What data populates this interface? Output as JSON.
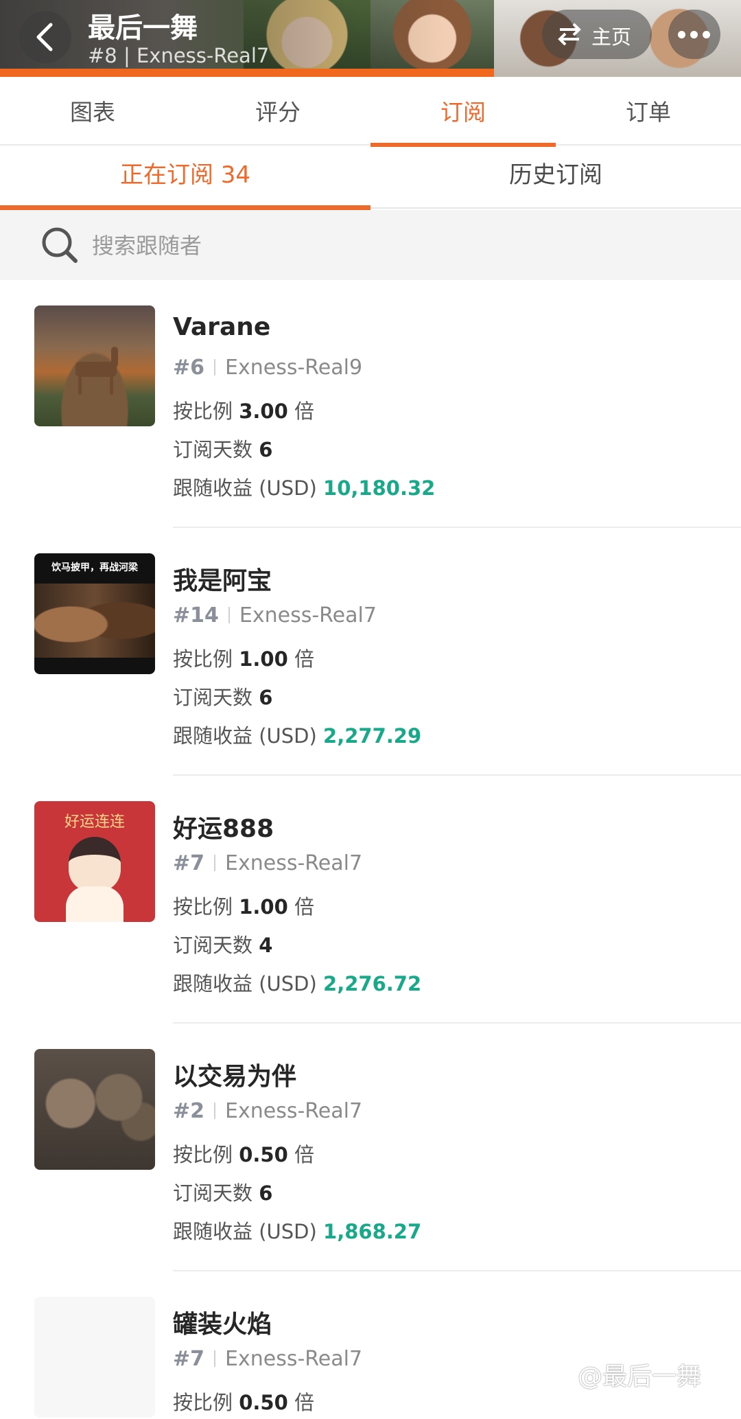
{
  "header": {
    "trader_name": "最后一舞",
    "trader_rank": "#8",
    "trader_account": "Exness-Real7",
    "home_label": "主页"
  },
  "tabs": [
    {
      "label": "图表",
      "active": false
    },
    {
      "label": "评分",
      "active": false
    },
    {
      "label": "订阅",
      "active": true
    },
    {
      "label": "订单",
      "active": false
    }
  ],
  "subtabs": {
    "current_label": "正在订阅 34",
    "history_label": "历史订阅"
  },
  "search": {
    "placeholder": "搜索跟随者"
  },
  "labels": {
    "ratio_prefix": "按比例",
    "ratio_suffix": "倍",
    "days_label": "订阅天数",
    "profit_label": "跟随收益 (USD)"
  },
  "followers": [
    {
      "name": "Varane",
      "rank": "#6",
      "account": "Exness-Real9",
      "ratio": "3.00",
      "days": "6",
      "profit": "10,180.32",
      "thumb": "deer"
    },
    {
      "name": "我是阿宝",
      "rank": "#14",
      "account": "Exness-Real7",
      "ratio": "1.00",
      "days": "6",
      "profit": "2,277.29",
      "thumb": "horse",
      "thumb_caption": "饮马披甲，再战河梁"
    },
    {
      "name": "好运888",
      "rank": "#7",
      "account": "Exness-Real7",
      "ratio": "1.00",
      "days": "4",
      "profit": "2,276.72",
      "thumb": "luck",
      "thumb_caption": "好运连连"
    },
    {
      "name": "以交易为伴",
      "rank": "#2",
      "account": "Exness-Real7",
      "ratio": "0.50",
      "days": "6",
      "profit": "1,868.27",
      "thumb": "kids"
    },
    {
      "name": "罐装火焰",
      "rank": "#7",
      "account": "Exness-Real7",
      "ratio": "0.50",
      "thumb": "blank"
    }
  ],
  "watermark": "@最后一舞",
  "colors": {
    "accent": "#ee6a2c",
    "profit_green": "#18a88a"
  }
}
